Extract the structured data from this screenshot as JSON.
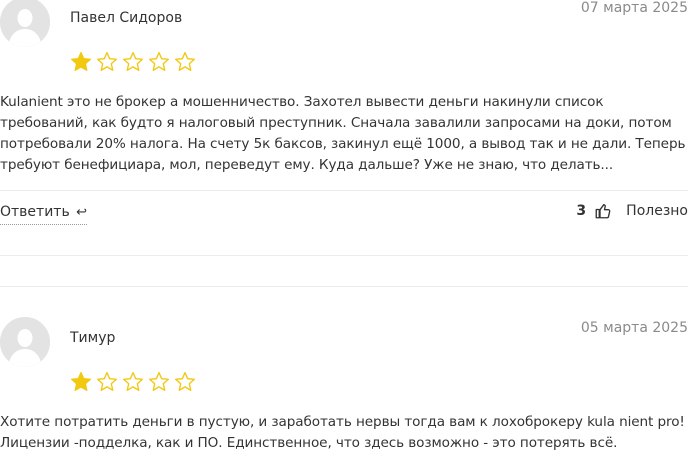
{
  "reviews": [
    {
      "author": "Павел Сидоров",
      "date": "07 марта 2025",
      "rating": 1,
      "rating_max": 5,
      "text": "Kulanient это не брокер а мошенничество. Захотел вывести деньги накинули список требований, как будто я налоговый преступник. Сначала завалили запросами на доки, потом потребовали 20% налога. На счету 5к баксов, закинул ещё 1000, а вывод так и не дали. Теперь требуют бенефициара, мол, переведут ему. Куда дальше? Уже не знаю, что делать...",
      "reply_label": "Ответить",
      "helpful_count": "3",
      "helpful_label": "Полезно"
    },
    {
      "author": "Тимур",
      "date": "05 марта 2025",
      "rating": 1,
      "rating_max": 5,
      "text": "Хотите потратить деньги в пустую, и заработать нервы тогда вам к лохоброкеру kula nient pro! Лицензии -подделка, как и ПО. Единственное, что здесь возможно - это потерять всё."
    }
  ],
  "colors": {
    "star_filled": "#f2c811",
    "star_outline": "#f2c811",
    "date": "#8a8a8a",
    "text": "#333333"
  },
  "icons": {
    "reply": "reply-arrow-icon",
    "helpful": "thumbs-up-icon",
    "avatar": "user-placeholder-icon"
  }
}
